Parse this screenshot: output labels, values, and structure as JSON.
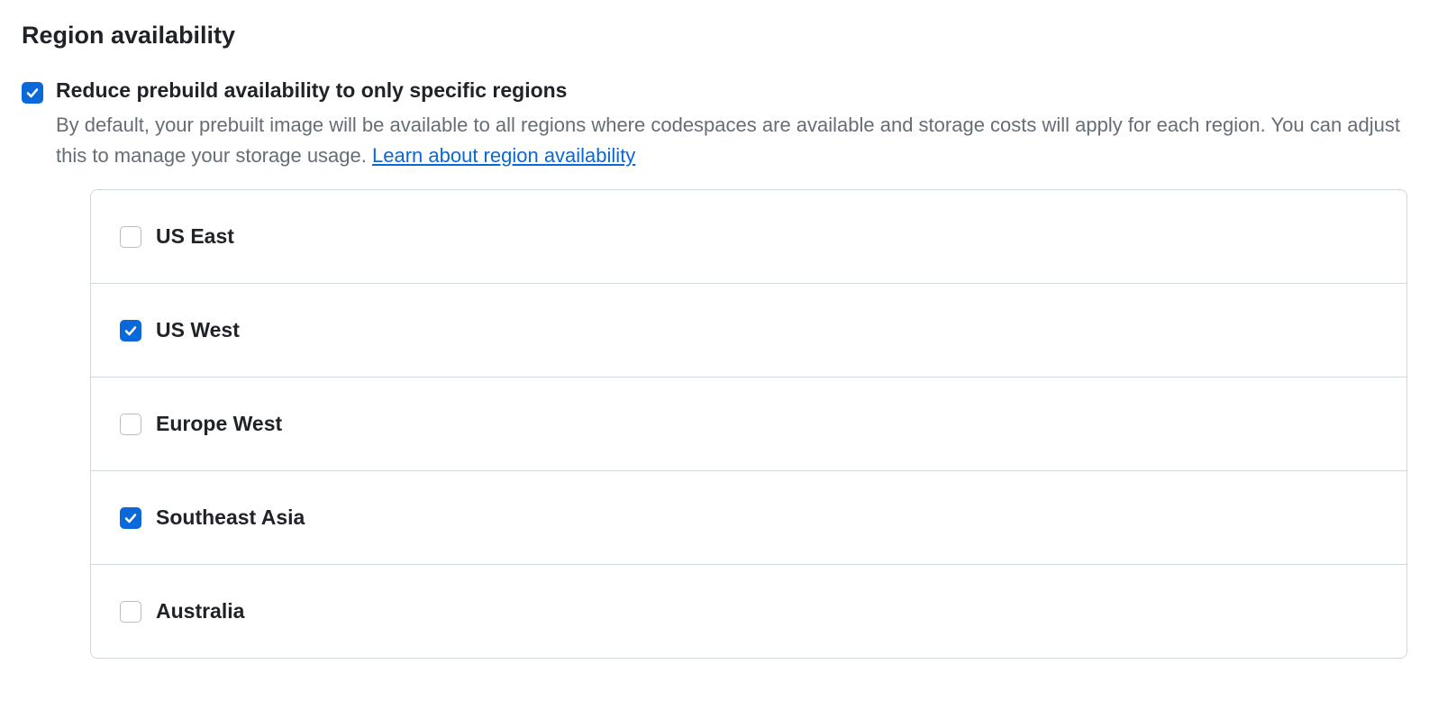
{
  "section": {
    "title": "Region availability"
  },
  "option": {
    "checked": true,
    "label": "Reduce prebuild availability to only specific regions",
    "description": "By default, your prebuilt image will be available to all regions where codespaces are available and storage costs will apply for each region. You can adjust this to manage your storage usage. ",
    "link_text": "Learn about region availability"
  },
  "regions": [
    {
      "name": "US East",
      "checked": false
    },
    {
      "name": "US West",
      "checked": true
    },
    {
      "name": "Europe West",
      "checked": false
    },
    {
      "name": "Southeast Asia",
      "checked": true
    },
    {
      "name": "Australia",
      "checked": false
    }
  ]
}
